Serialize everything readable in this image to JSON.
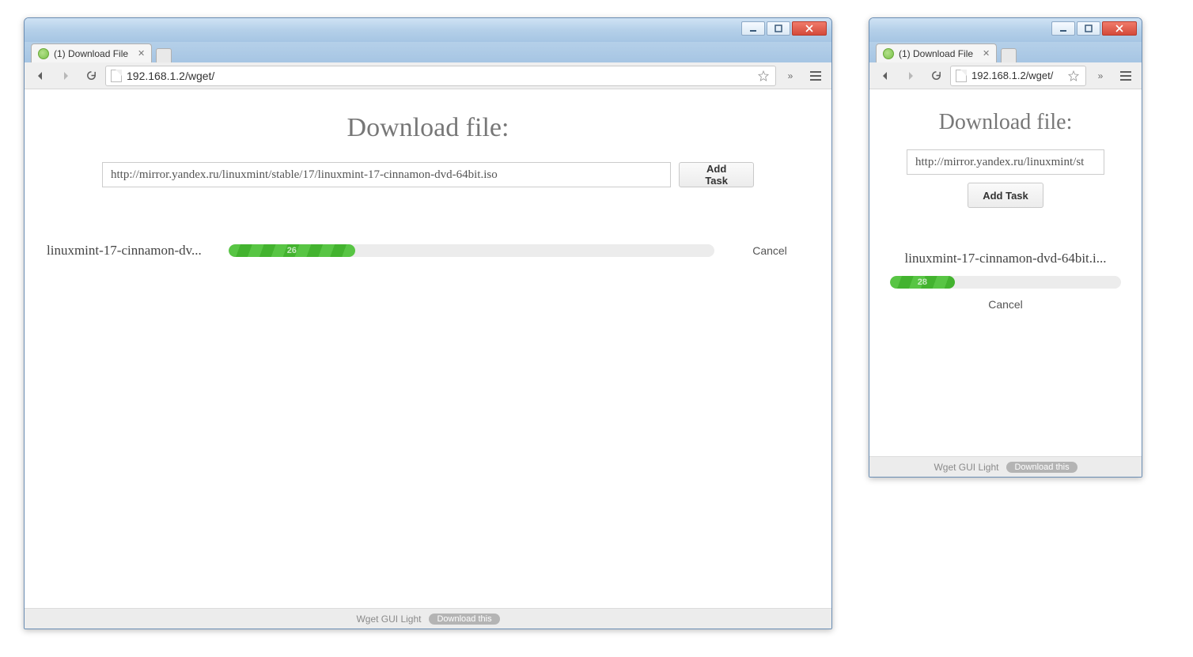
{
  "wide": {
    "tab_title": "(1) Download File",
    "address": "192.168.1.2/wget/",
    "heading": "Download file:",
    "url_value": "http://mirror.yandex.ru/linuxmint/stable/17/linuxmint-17-cinnamon-dvd-64bit.iso",
    "add_task_label": "Add Task",
    "task_name": "linuxmint-17-cinnamon-dv...",
    "progress_percent": 26,
    "progress_label": "26",
    "cancel_label": "Cancel",
    "footer_text": "Wget GUI Light",
    "footer_pill": "Download this"
  },
  "narrow": {
    "tab_title": "(1) Download File",
    "address": "192.168.1.2/wget/",
    "heading": "Download file:",
    "url_value": "http://mirror.yandex.ru/linuxmint/st",
    "add_task_label": "Add Task",
    "task_name": "linuxmint-17-cinnamon-dvd-64bit.i...",
    "progress_percent": 28,
    "progress_label": "28",
    "cancel_label": "Cancel",
    "footer_text": "Wget GUI Light",
    "footer_pill": "Download this"
  },
  "colors": {
    "progress_green_a": "#58c544",
    "progress_green_b": "#43b32f"
  }
}
